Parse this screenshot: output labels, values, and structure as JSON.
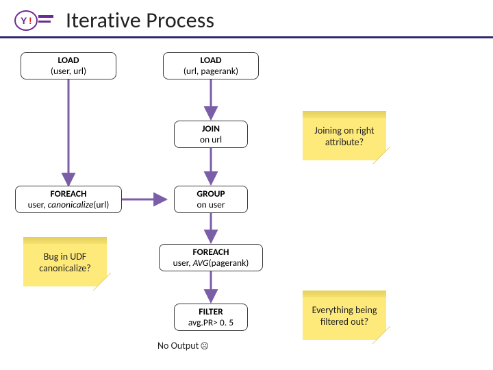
{
  "header": {
    "title": "Iterative Process",
    "logo_name": "yahoo-logo"
  },
  "nodes": {
    "load_left": {
      "l1": "LOAD",
      "l2": "(user, url)"
    },
    "load_right": {
      "l1": "LOAD",
      "l2": "(url, pagerank)"
    },
    "join": {
      "l1": "JOIN",
      "l2": "on url"
    },
    "foreach_c": {
      "l1": "FOREACH",
      "l2a": "user, ",
      "l2b": "canonicalize",
      "l2c": "(url)"
    },
    "group": {
      "l1": "GROUP",
      "l2": "on user"
    },
    "foreach_avg": {
      "l1": "FOREACH",
      "l2a": "user, ",
      "l2b": "AVG",
      "l2c": "(pagerank)"
    },
    "filter": {
      "l1": "FILTER",
      "l2": "avg.PR> 0. 5"
    }
  },
  "stickies": {
    "join_attr": "Joining on right attribute?",
    "udf_bug": "Bug in UDF canonicalize?",
    "filtered": "Everything being filtered out?"
  },
  "no_output": "No Output",
  "colors": {
    "arrow": "#7a5ea8",
    "header_rule": "#2e2a6f",
    "sticky_bg": "#feea7a"
  }
}
